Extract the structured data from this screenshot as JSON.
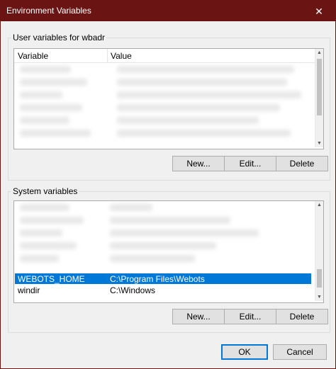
{
  "window": {
    "title": "Environment Variables",
    "close_glyph": "✕"
  },
  "user_vars": {
    "group_label": "User variables for wbadr",
    "columns": [
      "Variable",
      "Value"
    ],
    "buttons": {
      "new": "New...",
      "edit": "Edit...",
      "delete": "Delete"
    }
  },
  "system_vars": {
    "group_label": "System variables",
    "rows": [
      {
        "variable": "WEBOTS_HOME",
        "value": "C:\\Program Files\\Webots",
        "selected": true
      },
      {
        "variable": "windir",
        "value": "C:\\Windows",
        "selected": false
      }
    ],
    "buttons": {
      "new": "New...",
      "edit": "Edit...",
      "delete": "Delete"
    }
  },
  "footer": {
    "ok": "OK",
    "cancel": "Cancel"
  },
  "colors": {
    "titlebar": "#6b1414",
    "selection": "#0078d7"
  }
}
